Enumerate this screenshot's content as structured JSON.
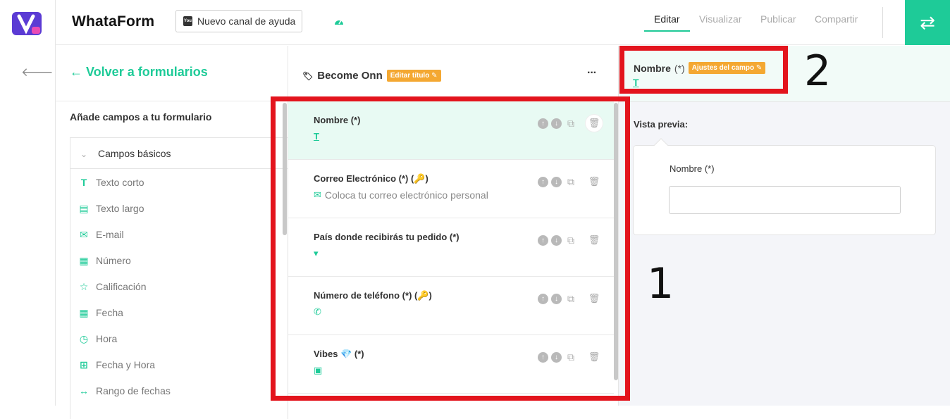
{
  "brand": {
    "name": "WhataForm",
    "help_button": "Nuevo canal de ayuda",
    "accent_color": "#1ecb98",
    "brand_purple": "#5b3bd4"
  },
  "nav": {
    "tabs": [
      "Editar",
      "Visualizar",
      "Publicar",
      "Compartir"
    ],
    "active_tab": "Editar"
  },
  "left": {
    "back_link": "← Volver a formularios",
    "section_title": "Añade campos a tu formulario",
    "group_title": "Campos básicos",
    "fields": [
      {
        "label": "Texto corto",
        "icon": "text-icon"
      },
      {
        "label": "Texto largo",
        "icon": "document-icon"
      },
      {
        "label": "E-mail",
        "icon": "envelope-icon"
      },
      {
        "label": "Número",
        "icon": "calculator-icon"
      },
      {
        "label": "Calificación",
        "icon": "star-icon"
      },
      {
        "label": "Fecha",
        "icon": "calendar-icon"
      },
      {
        "label": "Hora",
        "icon": "clock-icon"
      },
      {
        "label": "Fecha y Hora",
        "icon": "calendar-plus-icon"
      },
      {
        "label": "Rango de fechas",
        "icon": "range-arrows-icon"
      }
    ]
  },
  "form": {
    "title": "Become Onn",
    "edit_title_badge": "Editar título",
    "more": "···",
    "cards": [
      {
        "label": "Nombre (*)",
        "icon": "text-icon",
        "sub": "",
        "selected": true
      },
      {
        "label": "Correo Electrónico (*) (🔑)",
        "icon": "envelope-icon",
        "sub": "Coloca tu correo electrónico personal",
        "selected": false
      },
      {
        "label": "País donde recibirás tu pedido (*)",
        "icon": "dropdown-icon",
        "sub": "",
        "selected": false
      },
      {
        "label": "Número de teléfono (*) (🔑)",
        "icon": "whatsapp-icon",
        "sub": "",
        "selected": false
      },
      {
        "label": "Vibes 💎 (*)",
        "icon": "image-icon",
        "sub": "",
        "selected": false
      }
    ]
  },
  "right": {
    "field_name": "Nombre",
    "field_required": "(*)",
    "settings_badge": "Ajustes del campo",
    "preview_title": "Vista previa:",
    "preview_label": "Nombre (*)"
  },
  "annotations": {
    "box1_number": "1",
    "box2_number": "2",
    "color": "#e3141d"
  }
}
